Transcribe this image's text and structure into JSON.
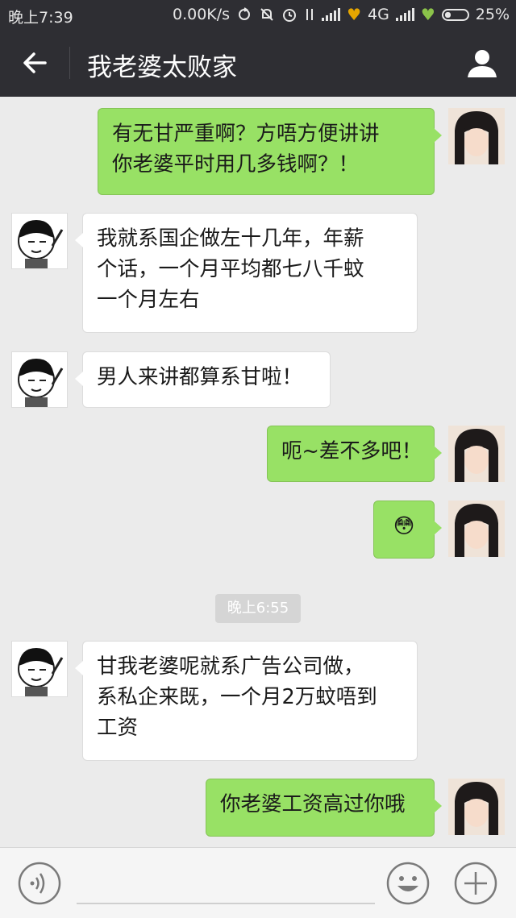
{
  "status_bar": {
    "time": "晚上7:39",
    "speed": "0.00K/s",
    "network": "4G",
    "battery": "25%"
  },
  "header": {
    "title": "我老婆太败家"
  },
  "messages": [
    {
      "side": "out",
      "lines": [
        "有无甘严重啊？方唔方便讲讲",
        "你老婆平时用几多钱啊？！"
      ]
    },
    {
      "side": "in",
      "lines": [
        "我就系国企做左十几年，年薪",
        "个话，一个月平均都七八千蚊",
        "一个月左右"
      ]
    },
    {
      "side": "in",
      "lines": [
        "男人来讲都算系甘啦！"
      ]
    },
    {
      "side": "out",
      "lines": [
        "呃~差不多吧！"
      ]
    },
    {
      "side": "out",
      "lines": [
        "😳"
      ]
    },
    {
      "side": "in",
      "lines": [
        "甘我老婆呢就系广告公司做，",
        "系私企来既，一个月2万蚊唔到",
        "工资"
      ]
    },
    {
      "side": "out",
      "lines": [
        "你老婆工资高过你哦"
      ]
    }
  ],
  "timestamp": "晚上6:55",
  "colors": {
    "header_bg": "#2e2e33",
    "chat_bg": "#ebebeb",
    "outgoing_bubble": "#98e165",
    "incoming_bubble": "#ffffff"
  }
}
